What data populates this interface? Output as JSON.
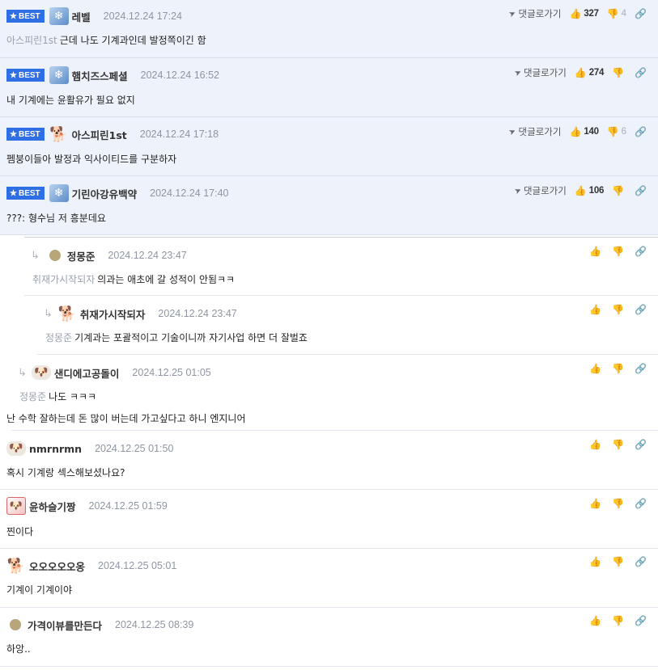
{
  "ui": {
    "best_label": "BEST",
    "reply_label": "댓글로가기"
  },
  "comments": [
    {
      "nick": "레벨",
      "date": "2024.12.24 17:24",
      "target": "아스피린1st",
      "text": "근데 나도 기계과인데 발정쪽이긴 함",
      "up": "327",
      "down": "4"
    },
    {
      "nick": "햄치즈스페셜",
      "date": "2024.12.24 16:52",
      "target": "",
      "text": "내 기계에는 윤활유가 필요 없지",
      "up": "274",
      "down": ""
    },
    {
      "nick": "아스피린1st",
      "date": "2024.12.24 17:18",
      "target": "",
      "text": "펨붕이들아 발정과 익사이티드를 구분하자",
      "up": "140",
      "down": "6"
    },
    {
      "nick": "기린아강유백약",
      "date": "2024.12.24 17:40",
      "target": "",
      "text": "???: 형수님 저 흥분데요",
      "up": "106",
      "down": ""
    },
    {
      "nick": "정몽준",
      "date": "2024.12.24 23:47",
      "target": "취재가시작되자",
      "text": "의과는 애초에 갈 성적이 안됨ㅋㅋ",
      "up": "",
      "down": ""
    },
    {
      "nick": "취재가시작되자",
      "date": "2024.12.24 23:47",
      "target": "정몽준",
      "text": "기계과는 포괄적이고 기술이니까 자기사업 하면 더 잘벌죠",
      "up": "",
      "down": ""
    },
    {
      "nick": "샌디에고공돌이",
      "date": "2024.12.25 01:05",
      "target": "정몽준",
      "text": "나도 ㅋㅋㅋ",
      "text2": "난 수학 잘하는데 돈 많이 버는데 가고싶다고 하니 엔지니어",
      "up": "",
      "down": ""
    },
    {
      "nick": "nmrnrmn",
      "date": "2024.12.25 01:50",
      "target": "",
      "text": "혹시 기계랑 섹스해보셨나요?",
      "up": "",
      "down": ""
    },
    {
      "nick": "윤하슬기짱",
      "date": "2024.12.25 01:59",
      "target": "",
      "text": "찐이다",
      "up": "",
      "down": ""
    },
    {
      "nick": "오오오오오옹",
      "date": "2024.12.25 05:01",
      "target": "",
      "text": "기계이 기계이야",
      "up": "",
      "down": ""
    },
    {
      "nick": "가격이뷰를만든다",
      "date": "2024.12.25 08:39",
      "target": "",
      "text": "하앙..",
      "up": "",
      "down": ""
    }
  ],
  "icons": {
    "star": "star-icon",
    "send": "send-icon",
    "thumb_up": "thumbs-up-icon",
    "thumb_down": "thumbs-down-icon",
    "link": "link-icon",
    "reply_arrow": "reply-arrow-icon"
  },
  "colors": {
    "best_badge": "#2e6fe6",
    "best_row_bg": "#eef2fb",
    "date": "#8e96a3",
    "target": "#9aa1ad"
  }
}
